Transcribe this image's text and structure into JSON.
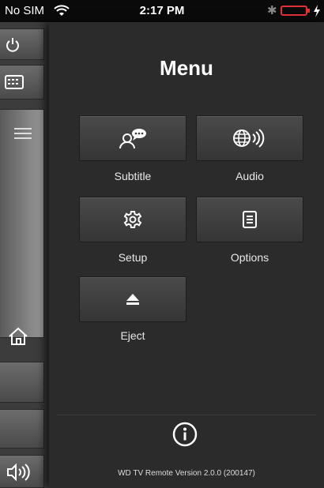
{
  "status_bar": {
    "carrier": "No SIM",
    "time": "2:17 PM",
    "wifi_icon": "wifi-icon",
    "bluetooth_icon": "bluetooth-icon",
    "battery_icon": "battery-icon",
    "battery_color": "#e0303a"
  },
  "sidebar": {
    "buttons": [
      {
        "icon": "power-icon"
      },
      {
        "icon": "keyboard-icon"
      },
      {
        "icon": "menu-lines-icon"
      },
      {
        "icon": "home-icon"
      },
      {
        "icon": ""
      },
      {
        "icon": ""
      },
      {
        "icon": "volume-icon"
      }
    ]
  },
  "menu": {
    "title": "Menu",
    "items": [
      {
        "label": "Subtitle",
        "icon": "subtitle-icon"
      },
      {
        "label": "Audio",
        "icon": "audio-icon"
      },
      {
        "label": "Setup",
        "icon": "gear-icon"
      },
      {
        "label": "Options",
        "icon": "options-icon"
      },
      {
        "label": "Eject",
        "icon": "eject-icon"
      }
    ],
    "info_icon": "info-icon",
    "version": "WD TV Remote Version 2.0.0 (200147)"
  }
}
